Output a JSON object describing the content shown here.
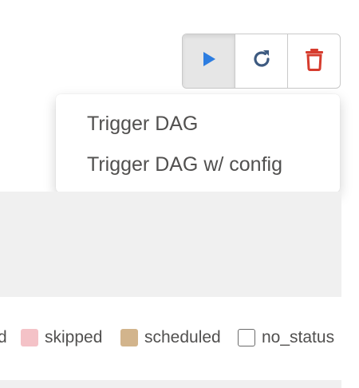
{
  "toolbar": {
    "trigger_icon": "play-icon",
    "refresh_icon": "refresh-icon",
    "delete_icon": "trash-icon",
    "trigger_color": "#2d7de0",
    "refresh_color": "#3d5a80",
    "delete_color": "#d63c2e"
  },
  "dropdown": {
    "items": [
      {
        "label": "Trigger DAG"
      },
      {
        "label": "Trigger DAG w/ config"
      }
    ]
  },
  "legend": {
    "items": [
      {
        "label": "d",
        "color": ""
      },
      {
        "label": "skipped",
        "color": "#f4c2c7"
      },
      {
        "label": "scheduled",
        "color": "#d2b48c"
      },
      {
        "label": "no_status",
        "color": "#ffffff"
      }
    ]
  }
}
